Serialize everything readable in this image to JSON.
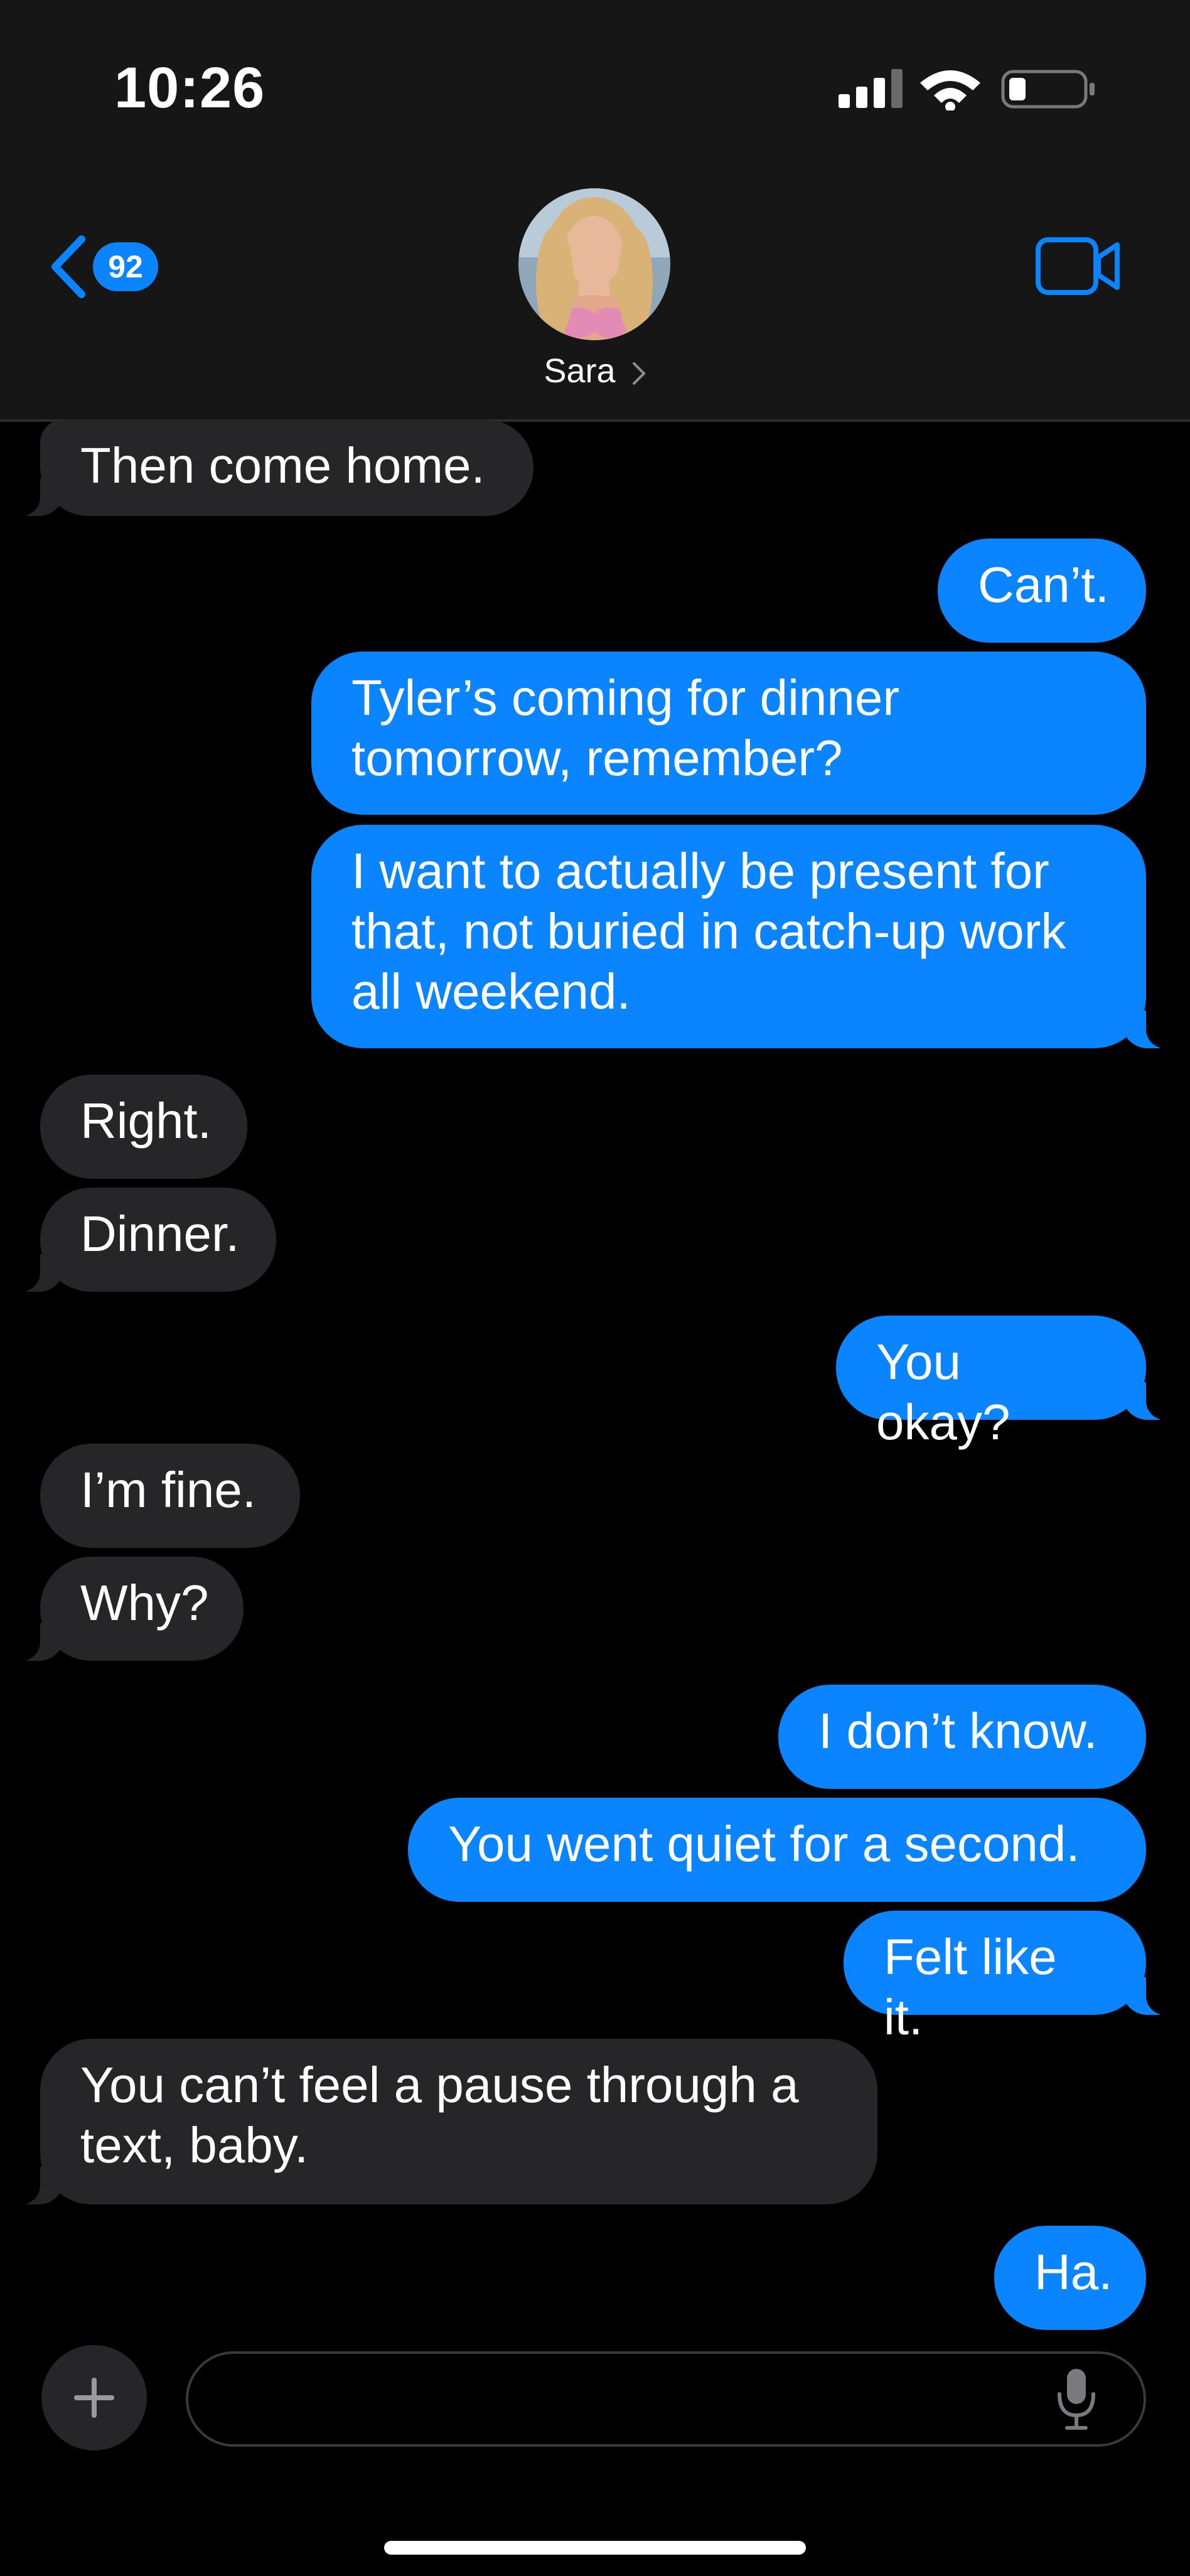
{
  "status_bar": {
    "time": "10:26"
  },
  "header": {
    "back_badge": "92",
    "contact_name": "Sara",
    "icons": [
      "chevron-left-icon",
      "video-camera-icon",
      "chevron-right-icon"
    ]
  },
  "messages": [
    {
      "text": "Then come home.",
      "from": "them"
    },
    {
      "text": "Can’t.",
      "from": "me"
    },
    {
      "text": "Tyler’s coming for dinner tomorrow, remember?",
      "from": "me"
    },
    {
      "text": "I want to actually be present for that, not buried in catch-up work all weekend.",
      "from": "me"
    },
    {
      "text": "Right.",
      "from": "them"
    },
    {
      "text": "Dinner.",
      "from": "them"
    },
    {
      "text": "You okay?",
      "from": "me"
    },
    {
      "text": "I’m fine.",
      "from": "them"
    },
    {
      "text": "Why?",
      "from": "them"
    },
    {
      "text": "I don’t know.",
      "from": "me"
    },
    {
      "text": "You went quiet for a second.",
      "from": "me"
    },
    {
      "text": "Felt like it.",
      "from": "me"
    },
    {
      "text": "You can’t feel a pause through a text, baby.",
      "from": "them"
    },
    {
      "text": "Ha.",
      "from": "me"
    }
  ],
  "composer": {
    "value": "",
    "placeholder": ""
  },
  "colors": {
    "accent": "#0a84ff",
    "incoming_bubble": "#262628",
    "header_bg": "#161616"
  }
}
